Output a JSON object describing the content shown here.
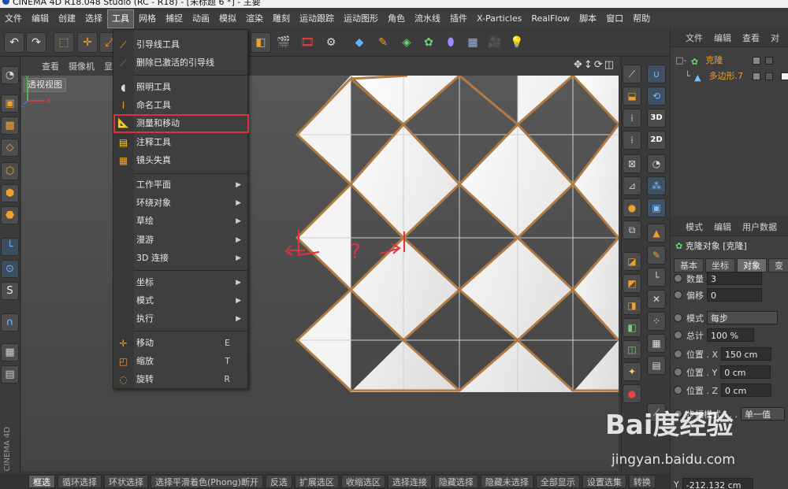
{
  "title_bar": {
    "text": "CINEMA 4D R18.048 Studio (RC - R18) - [未标题 6 *] - 主要"
  },
  "menubar": [
    "文件",
    "编辑",
    "创建",
    "选择",
    "工具",
    "网格",
    "捕捉",
    "动画",
    "模拟",
    "渲染",
    "雕刻",
    "运动跟踪",
    "运动图形",
    "角色",
    "流水线",
    "插件",
    "X-Particles",
    "RealFlow",
    "脚本",
    "窗口",
    "帮助"
  ],
  "active_menu": "工具",
  "tools_menu": {
    "items": [
      {
        "label": "引导线工具",
        "icon": "guide-line-icon"
      },
      {
        "label": "删除已激活的引导线",
        "icon": "delete-guide-icon"
      },
      {
        "label": "照明工具",
        "icon": "lighting-icon"
      },
      {
        "label": "命名工具",
        "icon": "naming-icon"
      },
      {
        "label": "测量和移动",
        "icon": "measure-icon",
        "highlighted": true
      },
      {
        "label": "注释工具",
        "icon": "annotation-icon"
      },
      {
        "label": "镜头失真",
        "icon": "lens-distortion-icon"
      },
      {
        "label": "工作平面",
        "submenu": true
      },
      {
        "label": "环绕对象",
        "submenu": true
      },
      {
        "label": "草绘",
        "submenu": true
      },
      {
        "label": "漫游",
        "submenu": true
      },
      {
        "label": "3D 连接",
        "submenu": true
      },
      {
        "label": "坐标",
        "submenu": true
      },
      {
        "label": "模式",
        "submenu": true
      },
      {
        "label": "执行",
        "submenu": true
      },
      {
        "label": "移动",
        "icon": "move-icon",
        "shortcut": "E"
      },
      {
        "label": "缩放",
        "icon": "scale-icon",
        "shortcut": "T"
      },
      {
        "label": "旋转",
        "icon": "rotate-icon",
        "shortcut": "R"
      }
    ]
  },
  "viewport": {
    "menu": [
      "查看",
      "摄像机",
      "显"
    ],
    "label": "透视视图",
    "annotation": "?"
  },
  "object_manager": {
    "tabs": [
      "文件",
      "编辑",
      "查看",
      "对"
    ],
    "objects": [
      {
        "name": "克隆",
        "icon": "cloner-icon"
      },
      {
        "name": "多边形.7",
        "icon": "polygon-icon"
      }
    ]
  },
  "attribute_manager": {
    "tabs": [
      "模式",
      "编辑",
      "用户数据"
    ],
    "title": "克隆对象 [克隆]",
    "subtabs": [
      "基本",
      "坐标",
      "对象",
      "变"
    ],
    "active_subtab": "对象",
    "rows": [
      {
        "label": "数量",
        "value": "3"
      },
      {
        "label": "偏移",
        "value": "0"
      },
      {
        "label": "模式",
        "value": "每步"
      },
      {
        "label": "总计",
        "value": "100 %"
      },
      {
        "label": "位置 . X",
        "value": "150 cm"
      },
      {
        "label": "位置 . Y",
        "value": "0 cm"
      },
      {
        "label": "位置 . Z",
        "value": "0 cm"
      },
      {
        "label": "步幅模式 . . .",
        "value": "单一值"
      },
      {
        "label": "Y",
        "value": "-212.132 cm"
      }
    ]
  },
  "bottom_bar": [
    "框选",
    "循环选择",
    "环状选择",
    "选择平滑着色(Phong)断开",
    "反选",
    "扩展选区",
    "收缩选区",
    "选择连接",
    "隐藏选择",
    "隐藏未选择",
    "全部显示",
    "设置选集",
    "转换"
  ],
  "left_vertical_label": "CINEMA 4D",
  "watermark": {
    "brand": "Bai度经验",
    "url": "jingyan.baidu.com"
  },
  "colors": {
    "highlight_box": "#e0323c",
    "annotation": "#e0323c",
    "accent": "#f0a030",
    "selection_blue": "#6db2ff"
  }
}
